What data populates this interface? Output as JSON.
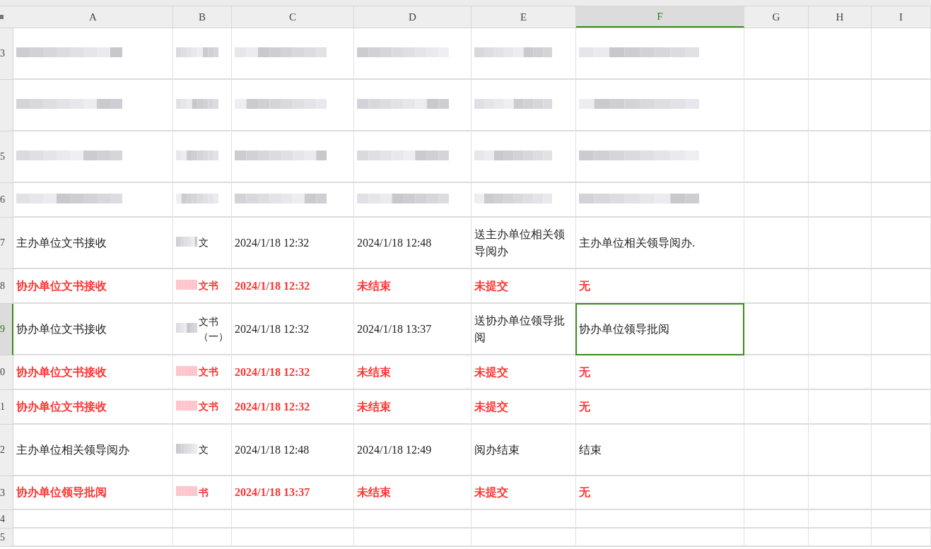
{
  "columns": [
    {
      "label": "A",
      "selected": false
    },
    {
      "label": "B",
      "selected": false
    },
    {
      "label": "C",
      "selected": false
    },
    {
      "label": "D",
      "selected": false
    },
    {
      "label": "E",
      "selected": false
    },
    {
      "label": "F",
      "selected": true
    },
    {
      "label": "G",
      "selected": false
    },
    {
      "label": "H",
      "selected": false
    },
    {
      "label": "I",
      "selected": false
    }
  ],
  "rows": [
    {
      "number": "3",
      "redacted": true,
      "kind": "normal",
      "selected": false,
      "cells": []
    },
    {
      "redacted": true,
      "kind": "normal",
      "selected": false,
      "cells": []
    },
    {
      "number": "5",
      "redacted": true,
      "kind": "normal",
      "selected": false,
      "cells": []
    },
    {
      "number": "6",
      "redacted": true,
      "kind": "normal",
      "selected": false,
      "cells": []
    },
    {
      "number": "7",
      "redacted": false,
      "kind": "normal",
      "selected": false,
      "cells": [
        "主办单位文书接收",
        "文",
        "2024/1/18 12:32",
        "2024/1/18 12:48",
        "送主办单位相关领导阅办",
        "主办单位相关领导阅办."
      ]
    },
    {
      "number": "8",
      "redacted": false,
      "kind": "pending",
      "selected": false,
      "cells": [
        "协办单位文书接收",
        "文书",
        "2024/1/18 12:32",
        "未结束",
        "未提交",
        "无"
      ]
    },
    {
      "number": "9",
      "redacted": false,
      "kind": "normal",
      "selected": true,
      "cells": [
        "协办单位文书接收",
        "文书（一）",
        "2024/1/18 12:32",
        "2024/1/18 13:37",
        "送协办单位领导批阅",
        "协办单位领导批阅"
      ]
    },
    {
      "number": "0",
      "redacted": false,
      "kind": "pending",
      "selected": false,
      "cells": [
        "协办单位文书接收",
        "文书",
        "2024/1/18 12:32",
        "未结束",
        "未提交",
        "无"
      ]
    },
    {
      "number": "1",
      "redacted": false,
      "kind": "pending",
      "selected": false,
      "cells": [
        "协办单位文书接收",
        "文书",
        "2024/1/18 12:32",
        "未结束",
        "未提交",
        "无"
      ]
    },
    {
      "number": "2",
      "redacted": false,
      "kind": "normal",
      "selected": false,
      "cells": [
        "主办单位相关领导阅办",
        "文",
        "2024/1/18 12:48",
        "2024/1/18 12:49",
        "阅办结束",
        "结束"
      ]
    },
    {
      "number": "3",
      "redacted": false,
      "kind": "pending",
      "selected": false,
      "cells": [
        "协办单位领导批阅",
        "书",
        "2024/1/18 13:37",
        "未结束",
        "未提交",
        "无"
      ]
    },
    {
      "number": "4",
      "redacted": false,
      "kind": "normal",
      "selected": false,
      "cells": []
    },
    {
      "number": "5",
      "redacted": false,
      "kind": "normal",
      "selected": false,
      "cells": []
    }
  ]
}
